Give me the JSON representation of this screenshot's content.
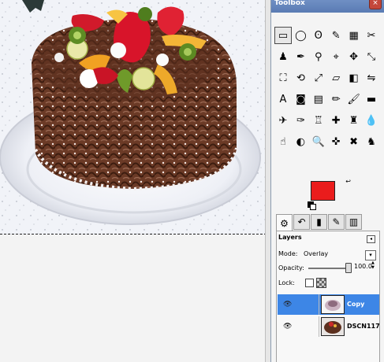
{
  "toolbox": {
    "title": "Toolbox",
    "close_glyph": "×",
    "tools": [
      {
        "icon": "rect-select-icon",
        "glyph": "▭"
      },
      {
        "icon": "ellipse-select-icon",
        "glyph": "◯"
      },
      {
        "icon": "free-select-icon",
        "glyph": "ʘ"
      },
      {
        "icon": "fuzzy-select-icon",
        "glyph": "✎"
      },
      {
        "icon": "color-select-icon",
        "glyph": "▦"
      },
      {
        "icon": "scissors-select-icon",
        "glyph": "✂"
      },
      {
        "icon": "foreground-select-icon",
        "glyph": "♟"
      },
      {
        "icon": "paths-icon",
        "glyph": "✒"
      },
      {
        "icon": "color-picker-icon",
        "glyph": "⚲"
      },
      {
        "icon": "measure-icon",
        "glyph": "⌖"
      },
      {
        "icon": "move-icon",
        "glyph": "✥"
      },
      {
        "icon": "align-icon",
        "glyph": "⤡"
      },
      {
        "icon": "crop-icon",
        "glyph": "⛶"
      },
      {
        "icon": "rotate-icon",
        "glyph": "⟲"
      },
      {
        "icon": "scale-icon",
        "glyph": "⤢"
      },
      {
        "icon": "shear-icon",
        "glyph": "▱"
      },
      {
        "icon": "perspective-icon",
        "glyph": "◧"
      },
      {
        "icon": "flip-icon",
        "glyph": "⇋"
      },
      {
        "icon": "text-icon",
        "glyph": "A"
      },
      {
        "icon": "bucket-fill-icon",
        "glyph": "◙"
      },
      {
        "icon": "blend-icon",
        "glyph": "▤"
      },
      {
        "icon": "pencil-icon",
        "glyph": "✏"
      },
      {
        "icon": "paintbrush-icon",
        "glyph": "🖌"
      },
      {
        "icon": "eraser-icon",
        "glyph": "▬"
      },
      {
        "icon": "airbrush-icon",
        "glyph": "✈"
      },
      {
        "icon": "ink-icon",
        "glyph": "✑"
      },
      {
        "icon": "clone-icon",
        "glyph": "♖"
      },
      {
        "icon": "heal-icon",
        "glyph": "✚"
      },
      {
        "icon": "perspective-clone-icon",
        "glyph": "♜"
      },
      {
        "icon": "blur-icon",
        "glyph": "💧"
      },
      {
        "icon": "smudge-icon",
        "glyph": "☝"
      },
      {
        "icon": "dodge-burn-icon",
        "glyph": "◐"
      },
      {
        "icon": "magnify-icon",
        "glyph": "🔍"
      },
      {
        "icon": "cage-transform-icon",
        "glyph": "✜"
      },
      {
        "icon": "fuzzy-select-2-icon",
        "glyph": "✖"
      },
      {
        "icon": "stamp-icon",
        "glyph": "♞"
      }
    ],
    "foreground_color": "#ea1c1c",
    "background_color": "#ffffff",
    "tabs": [
      {
        "icon": "tool-options-icon",
        "glyph": "⚙"
      },
      {
        "icon": "undo-history-icon",
        "glyph": "↶"
      },
      {
        "icon": "gradient-tab-icon",
        "glyph": "▮"
      },
      {
        "icon": "brushes-tab-icon",
        "glyph": "✎"
      },
      {
        "icon": "patterns-tab-icon",
        "glyph": "▥"
      }
    ]
  },
  "layers": {
    "title": "Layers",
    "mode_label": "Mode:",
    "mode_value": "Overlay",
    "opacity_label": "Opacity:",
    "opacity_value": "100.0",
    "lock_label": "Lock:",
    "items": [
      {
        "name": "Copy",
        "selected": true
      },
      {
        "name": "DSCN117",
        "selected": false
      }
    ]
  }
}
